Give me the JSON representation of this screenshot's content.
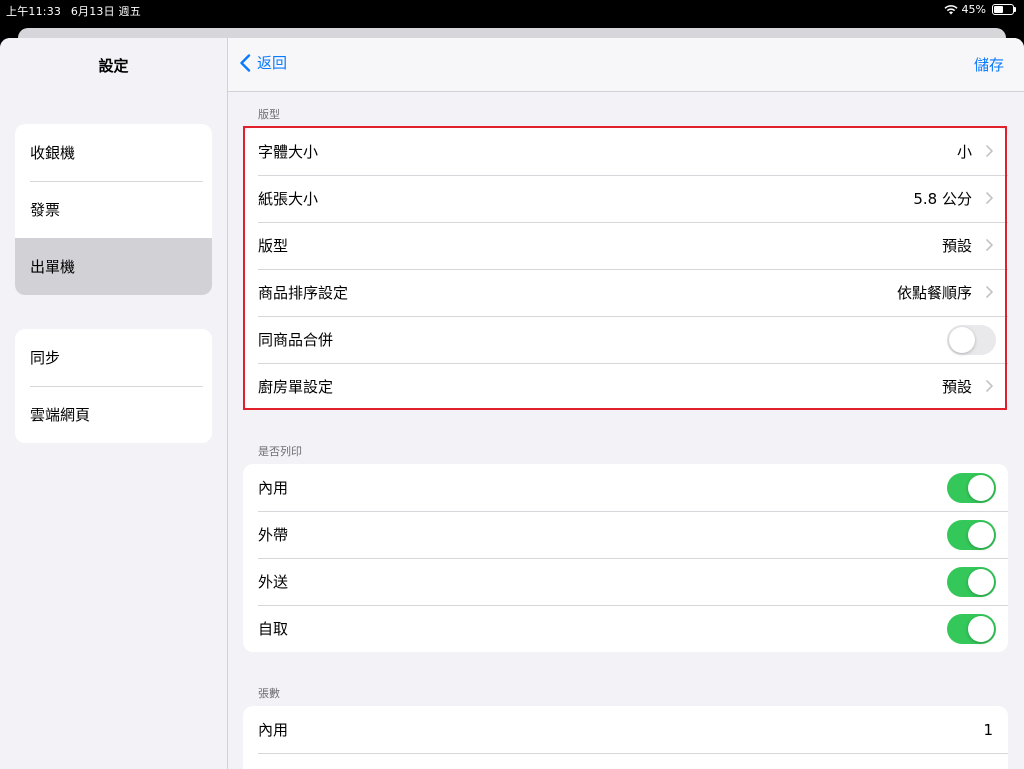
{
  "status_bar": {
    "time": "上午11:33",
    "date": "6月13日 週五",
    "battery": "45%",
    "battery_level": 0.45
  },
  "sidebar": {
    "title": "設定",
    "groups": [
      {
        "items": [
          {
            "label": "收銀機",
            "selected": false
          },
          {
            "label": "發票",
            "selected": false
          },
          {
            "label": "出單機",
            "selected": true
          }
        ]
      },
      {
        "items": [
          {
            "label": "同步",
            "selected": false
          },
          {
            "label": "雲端網頁",
            "selected": false
          }
        ]
      }
    ]
  },
  "navbar": {
    "back_label": "返回",
    "save_label": "儲存"
  },
  "sections": {
    "layout": {
      "header": "版型",
      "rows": [
        {
          "label": "字體大小",
          "value": "小"
        },
        {
          "label": "紙張大小",
          "value": "5.8 公分"
        },
        {
          "label": "版型",
          "value": "預設"
        },
        {
          "label": "商品排序設定",
          "value": "依點餐順序"
        },
        {
          "label": "同商品合併",
          "toggle": false
        },
        {
          "label": "廚房單設定",
          "value": "預設"
        }
      ]
    },
    "print": {
      "header": "是否列印",
      "rows": [
        {
          "label": "內用",
          "toggle": true
        },
        {
          "label": "外帶",
          "toggle": true
        },
        {
          "label": "外送",
          "toggle": true
        },
        {
          "label": "自取",
          "toggle": true
        }
      ]
    },
    "copies": {
      "header": "張數",
      "rows": [
        {
          "label": "內用",
          "value": "1"
        }
      ]
    }
  },
  "colors": {
    "accent": "#0a7aff",
    "toggle_on": "#34c759",
    "highlight": "#e0202a"
  }
}
